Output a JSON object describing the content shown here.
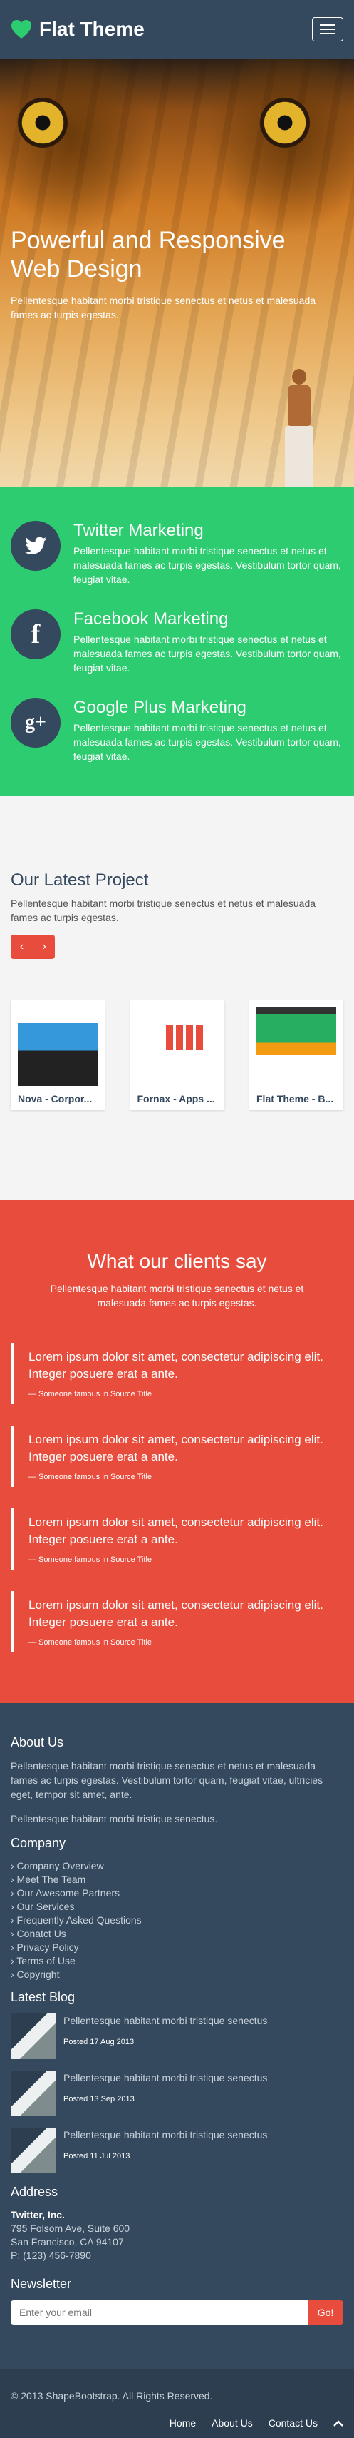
{
  "navbar": {
    "brand": "Flat Theme",
    "brand_icon": "heart-icon",
    "menu_icon": "hamburger-icon",
    "colors": {
      "accent": "#2ecc71",
      "bg": "#34495e"
    }
  },
  "hero": {
    "title": "Powerful and Responsive Web Design",
    "subtitle": "Pellentesque habitant morbi tristique senectus et netus et malesuada fames ac turpis egestas."
  },
  "services": {
    "items": [
      {
        "icon": "twitter-icon",
        "glyph": "🐦",
        "title": "Twitter Marketing",
        "text": "Pellentesque habitant morbi tristique senectus et netus et malesuada fames ac turpis egestas. Vestibulum tortor quam, feugiat vitae."
      },
      {
        "icon": "facebook-icon",
        "glyph": "f",
        "title": "Facebook Marketing",
        "text": "Pellentesque habitant morbi tristique senectus et netus et malesuada fames ac turpis egestas. Vestibulum tortor quam, feugiat vitae."
      },
      {
        "icon": "google-plus-icon",
        "glyph": "g+",
        "title": "Google Plus Marketing",
        "text": "Pellentesque habitant morbi tristique senectus et netus et malesuada fames ac turpis egestas. Vestibulum tortor quam, feugiat vitae."
      }
    ]
  },
  "projects": {
    "title": "Our Latest Project",
    "subtitle": "Pellentesque habitant morbi tristique senectus et netus et malesuada fames ac turpis egestas.",
    "prev_glyph": "‹",
    "next_glyph": "›",
    "items": [
      {
        "name": "Nova - Corpor..."
      },
      {
        "name": "Fornax - Apps ..."
      },
      {
        "name": "Flat Theme - B..."
      }
    ]
  },
  "testimonials": {
    "title": "What our clients say",
    "subtitle": "Pellentesque habitant morbi tristique senectus et netus et malesuada fames ac turpis egestas.",
    "items": [
      {
        "text": "Lorem ipsum dolor sit amet, consectetur adipiscing elit. Integer posuere erat a ante.",
        "by": "— Someone famous in Source Title"
      },
      {
        "text": "Lorem ipsum dolor sit amet, consectetur adipiscing elit. Integer posuere erat a ante.",
        "by": "— Someone famous in Source Title"
      },
      {
        "text": "Lorem ipsum dolor sit amet, consectetur adipiscing elit. Integer posuere erat a ante.",
        "by": "— Someone famous in Source Title"
      },
      {
        "text": "Lorem ipsum dolor sit amet, consectetur adipiscing elit. Integer posuere erat a ante.",
        "by": "— Someone famous in Source Title"
      }
    ]
  },
  "bottom": {
    "about_title": "About Us",
    "about_text_1": "Pellentesque habitant morbi tristique senectus et netus et malesuada fames ac turpis egestas. Vestibulum tortor quam, feugiat vitae, ultricies eget, tempor sit amet, ante.",
    "about_text_2": "Pellentesque habitant morbi tristique senectus.",
    "company_title": "Company",
    "company_links": [
      "› Company Overview",
      "› Meet The Team",
      "› Our Awesome Partners",
      "› Our Services",
      "› Frequently Asked Questions",
      "› Conatct Us",
      "› Privacy Policy",
      "› Terms of Use",
      "› Copyright"
    ],
    "blog_title": "Latest Blog",
    "blog_posts": [
      {
        "title": "Pellentesque habitant morbi tristique senectus",
        "date": "Posted 17 Aug 2013"
      },
      {
        "title": "Pellentesque habitant morbi tristique senectus",
        "date": "Posted 13 Sep 2013"
      },
      {
        "title": "Pellentesque habitant morbi tristique senectus",
        "date": "Posted 11 Jul 2013"
      }
    ],
    "address_title": "Address",
    "address": {
      "company": "Twitter, Inc.",
      "line1": "795 Folsom Ave, Suite 600",
      "line2": "San Francisco, CA 94107",
      "phone": "P: (123) 456-7890"
    },
    "newsletter_title": "Newsletter",
    "newsletter_placeholder": "Enter your email",
    "newsletter_button": "Go!"
  },
  "footer": {
    "copyright": "© 2013 ShapeBootstrap. All Rights Reserved.",
    "nav": [
      "Home",
      "About Us",
      "Contact Us"
    ],
    "gotop_icon": "chevron-up-icon"
  }
}
